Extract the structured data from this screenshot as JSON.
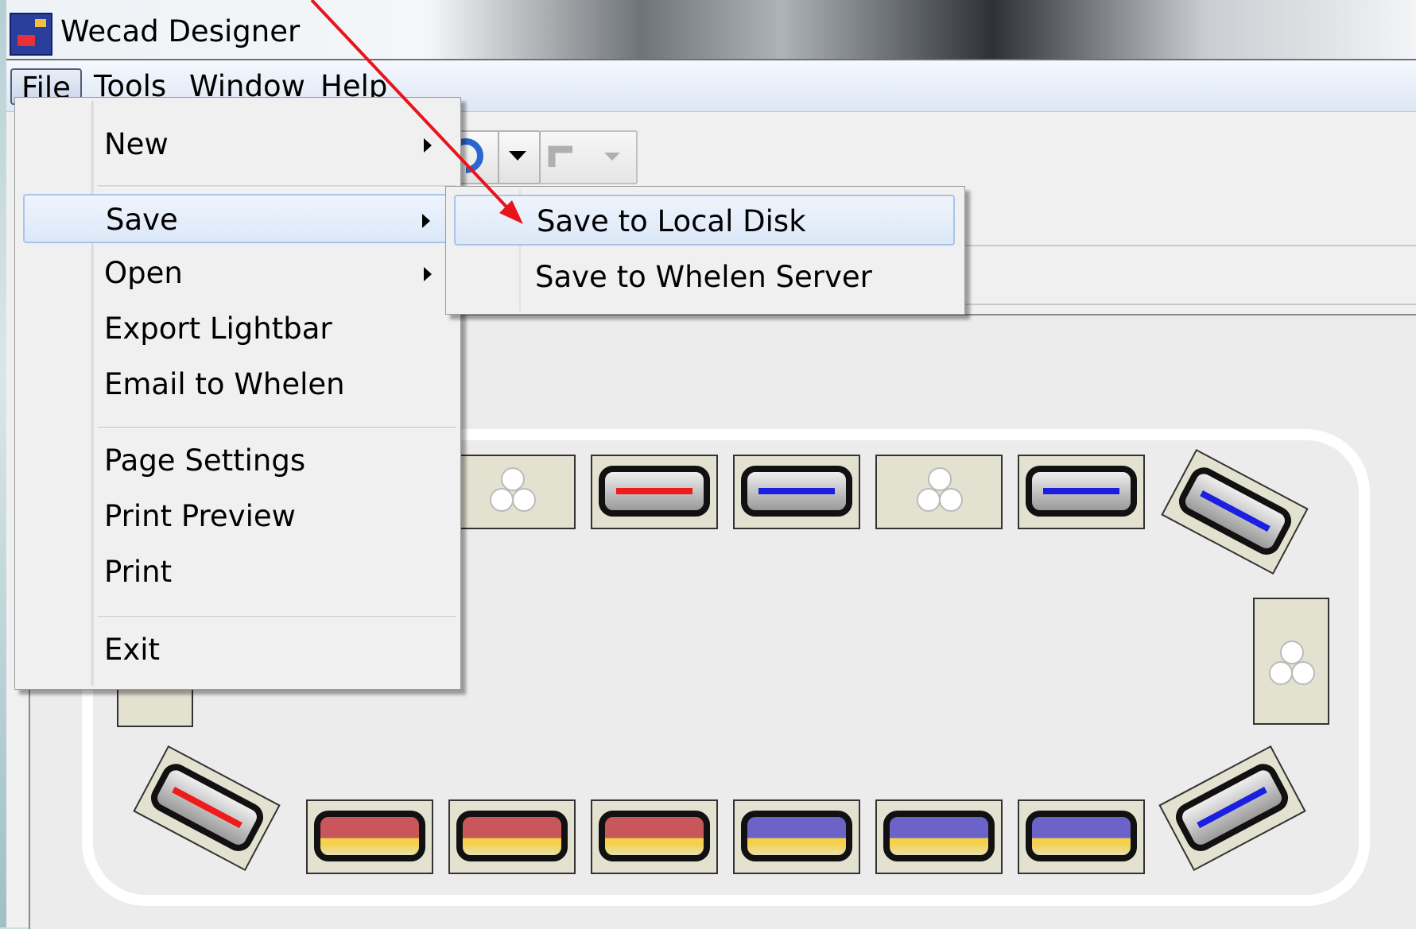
{
  "window": {
    "title": "Wecad Designer"
  },
  "menubar": {
    "items": [
      {
        "label": "File"
      },
      {
        "label": "Tools"
      },
      {
        "label": "Window"
      },
      {
        "label": "Help"
      }
    ]
  },
  "file_menu": {
    "items": [
      {
        "label": "New"
      },
      {
        "label": "Save"
      },
      {
        "label": "Open"
      },
      {
        "label": "Export Lightbar"
      },
      {
        "label": "Email to Whelen"
      },
      {
        "label": "Page Settings"
      },
      {
        "label": "Print Preview"
      },
      {
        "label": "Print"
      },
      {
        "label": "Exit"
      }
    ]
  },
  "save_submenu": {
    "items": [
      {
        "label": "Save to Local Disk"
      },
      {
        "label": "Save to Whelen Server"
      }
    ]
  },
  "colors": {
    "annotation_arrow": "#e8141c",
    "lamp_red": "#ef1b1b",
    "lamp_blue": "#1a1fe0",
    "menu_highlight": "#dce8f8"
  }
}
